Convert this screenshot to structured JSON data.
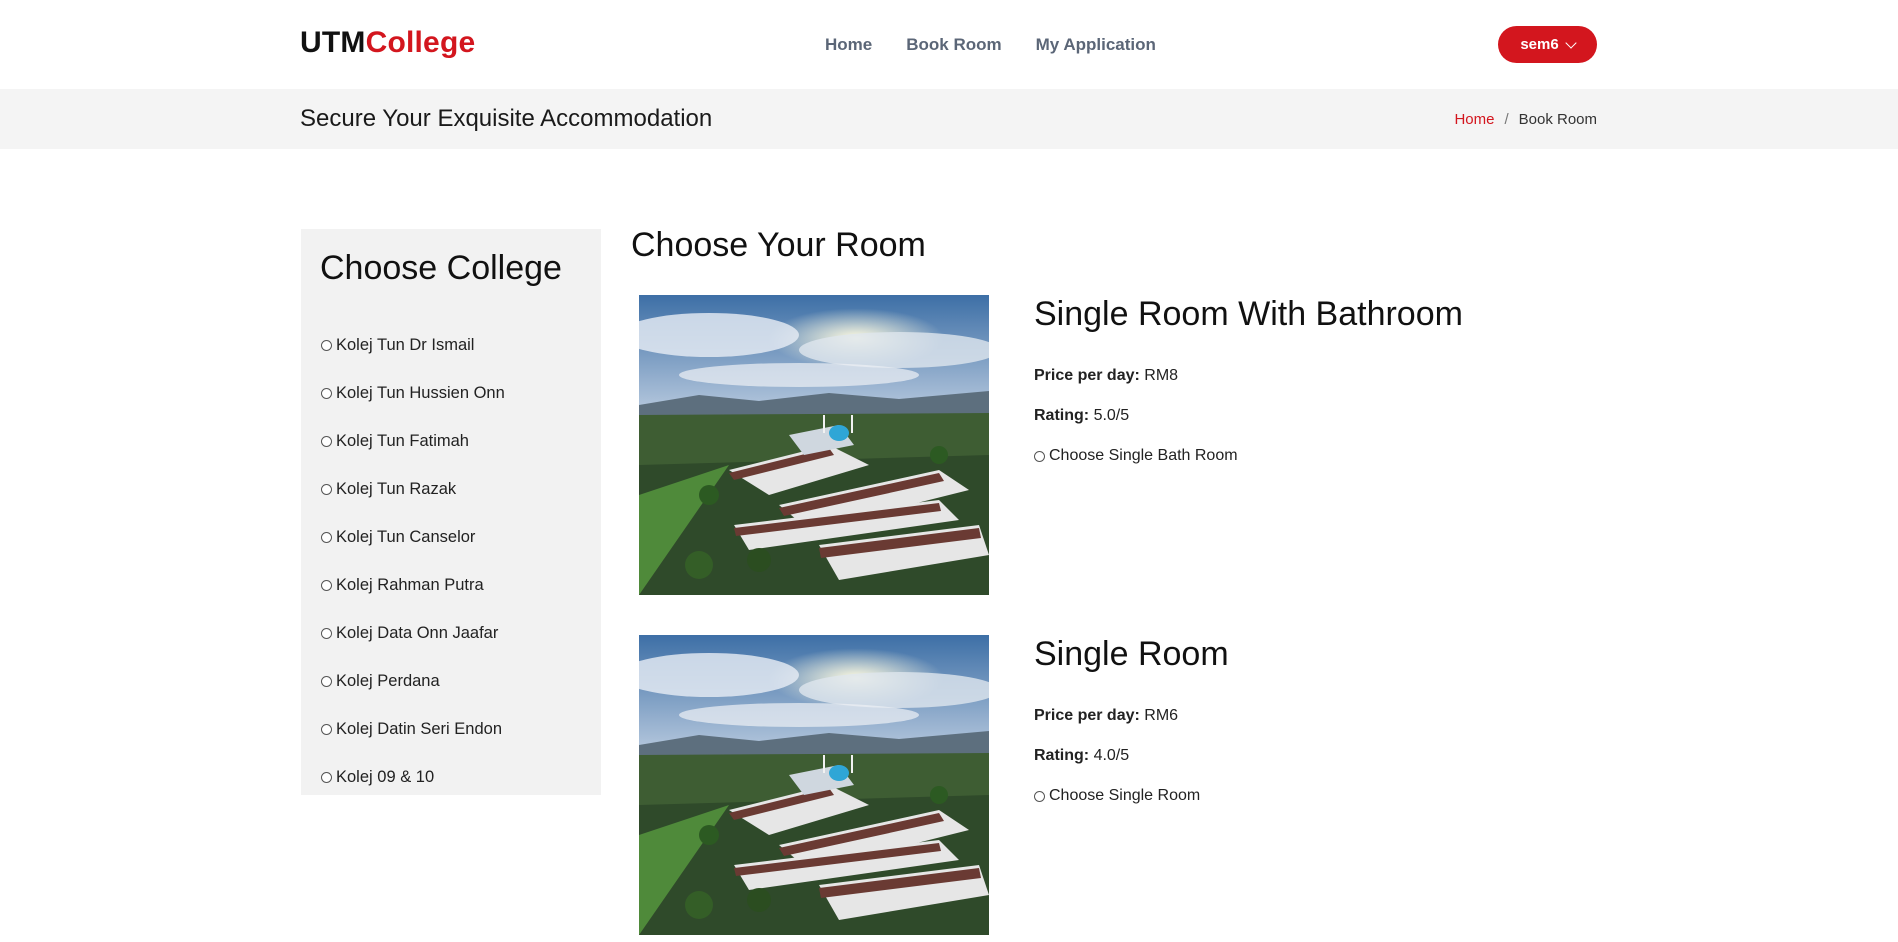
{
  "header": {
    "logo_part1": "UTM",
    "logo_part2": "College",
    "nav": [
      "Home",
      "Book Room",
      "My Application"
    ],
    "user_label": "sem6"
  },
  "titlebar": {
    "title": "Secure Your Exquisite Accommodation",
    "breadcrumb": [
      "Home",
      "Book Room"
    ],
    "breadcrumb_sep": "/"
  },
  "sidebar": {
    "title": "Choose College",
    "colleges": [
      "Kolej Tun Dr Ismail",
      "Kolej Tun Hussien Onn",
      "Kolej Tun Fatimah",
      "Kolej Tun Razak",
      "Kolej Tun Canselor",
      "Kolej Rahman Putra",
      "Kolej Data Onn Jaafar",
      "Kolej Perdana",
      "Kolej Datin Seri Endon",
      "Kolej 09 & 10"
    ]
  },
  "main": {
    "title": "Choose Your Room",
    "price_label": "Price per day:",
    "rating_label": "Rating:",
    "rooms": [
      {
        "name": "Single Room With Bathroom",
        "price": "RM8",
        "rating": "5.0/5",
        "choose_label": "Choose Single Bath Room"
      },
      {
        "name": "Single Room",
        "price": "RM6",
        "rating": "4.0/5",
        "choose_label": "Choose Single Room"
      }
    ]
  },
  "colors": {
    "accent": "#d3161e",
    "bar_bg": "#f4f4f4",
    "sidebar_bg": "#f2f2f2"
  }
}
